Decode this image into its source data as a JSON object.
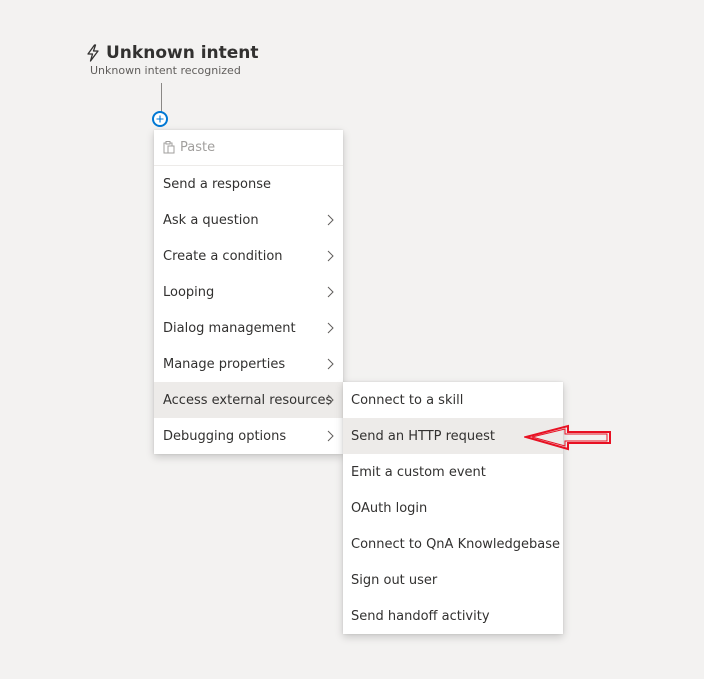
{
  "trigger": {
    "title": "Unknown intent",
    "subtitle": "Unknown intent recognized",
    "icon": "lightning-icon"
  },
  "add_node": {
    "icon": "plus-icon",
    "accent": "#0078d4"
  },
  "main_menu": {
    "items": [
      {
        "label": "Paste",
        "disabled": true,
        "icon": "paste-icon"
      },
      {
        "label": "Send a response",
        "submenu": false
      },
      {
        "label": "Ask a question",
        "submenu": true
      },
      {
        "label": "Create a condition",
        "submenu": true
      },
      {
        "label": "Looping",
        "submenu": true
      },
      {
        "label": "Dialog management",
        "submenu": true
      },
      {
        "label": "Manage properties",
        "submenu": true
      },
      {
        "label": "Access external resources",
        "submenu": true,
        "expanded": true
      },
      {
        "label": "Debugging options",
        "submenu": true
      }
    ]
  },
  "sub_menu": {
    "items": [
      {
        "label": "Connect to a skill"
      },
      {
        "label": "Send an HTTP request",
        "highlighted": true
      },
      {
        "label": "Emit a custom event"
      },
      {
        "label": "OAuth login"
      },
      {
        "label": "Connect to QnA Knowledgebase"
      },
      {
        "label": "Sign out user"
      },
      {
        "label": "Send handoff activity"
      }
    ]
  },
  "annotation": {
    "shape": "arrow-left-outline",
    "color": "#e81123"
  }
}
